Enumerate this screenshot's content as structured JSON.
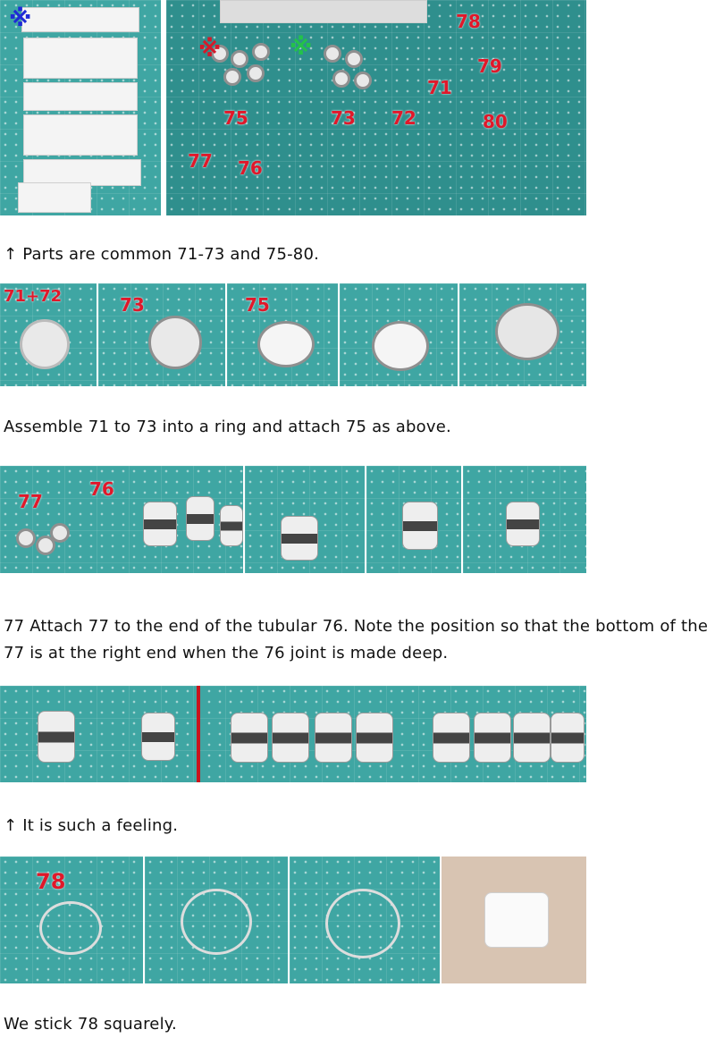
{
  "captions": {
    "c1": "↑ Parts are common 71-73 and 75-80.",
    "c2": "Assemble 71 to 73 into a ring and attach 75 as above.",
    "c3": "77 Attach 77 to the end of the tubular 76. Note the position so that the bottom of the 77 is at the right end when the 76 joint is made deep.",
    "c4": "↑ It is such a feeling.",
    "c5": "We stick 78 squarely."
  },
  "photo1": {
    "labels": [
      "78",
      "79",
      "71",
      "72",
      "73",
      "75",
      "80",
      "77",
      "76"
    ],
    "symbols": [
      "※",
      "※",
      "※"
    ]
  },
  "photo2": {
    "labels": [
      "71+72",
      "73",
      "75"
    ]
  },
  "photo3": {
    "labels": [
      "77",
      "76"
    ]
  },
  "photo5": {
    "labels": [
      "78"
    ]
  },
  "colors": {
    "mat": "#3fa6a3",
    "label_red": "#e0182a",
    "symbol_blue": "#1f2ad6",
    "symbol_red": "#d41a2a",
    "symbol_green": "#23c24a"
  }
}
